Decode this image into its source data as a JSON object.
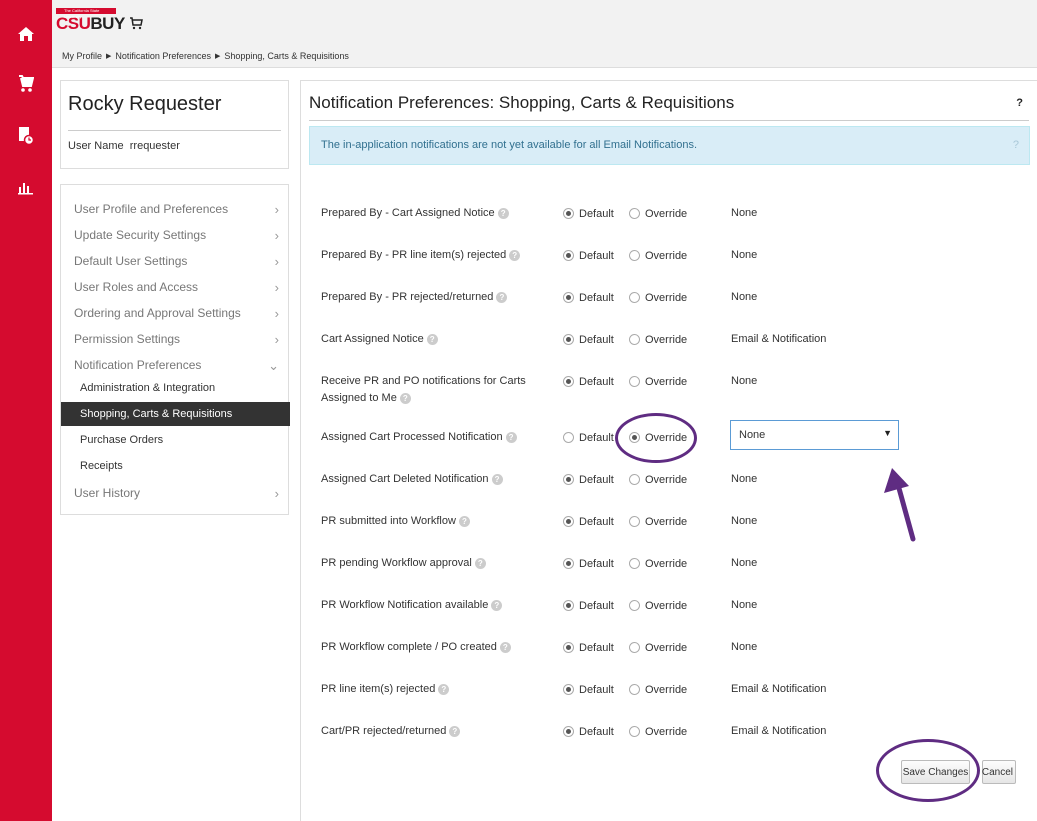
{
  "leftnav": {
    "icons": [
      "home-icon",
      "cart-icon",
      "document-clock-icon",
      "bar-chart-icon"
    ]
  },
  "header": {
    "logo_tagline": "The California State University",
    "logo_csu": "CSU",
    "logo_buy": "BUY"
  },
  "breadcrumb": [
    "My Profile",
    "Notification Preferences",
    "Shopping, Carts & Requisitions"
  ],
  "user": {
    "name": "Rocky Requester",
    "username_label": "User Name",
    "username": "rrequester"
  },
  "menu": {
    "items": [
      {
        "label": "User Profile and Preferences",
        "chevron": "›"
      },
      {
        "label": "Update Security Settings",
        "chevron": "›"
      },
      {
        "label": "Default User Settings",
        "chevron": "›"
      },
      {
        "label": "User Roles and Access",
        "chevron": "›"
      },
      {
        "label": "Ordering and Approval Settings",
        "chevron": "›"
      },
      {
        "label": "Permission Settings",
        "chevron": "›"
      },
      {
        "label": "Notification Preferences",
        "chevron": "⌄"
      }
    ],
    "subitems": [
      {
        "label": "Administration & Integration",
        "active": false
      },
      {
        "label": "Shopping, Carts & Requisitions",
        "active": true
      },
      {
        "label": "Purchase Orders",
        "active": false
      },
      {
        "label": "Receipts",
        "active": false
      }
    ],
    "last_item": {
      "label": "User History",
      "chevron": "›"
    }
  },
  "main": {
    "title": "Notification Preferences:  Shopping, Carts & Requisitions",
    "help": "?",
    "alert_text": "The in-application notifications are not yet available for all Email Notifications.",
    "alert_help": "?",
    "default_label": "Default",
    "override_label": "Override",
    "rows": [
      {
        "label": "Prepared By - Cart Assigned Notice",
        "selected": "default",
        "value": "None"
      },
      {
        "label": "Prepared By - PR line item(s) rejected",
        "selected": "default",
        "value": "None"
      },
      {
        "label": "Prepared By - PR rejected/returned",
        "selected": "default",
        "value": "None"
      },
      {
        "label": "Cart Assigned Notice",
        "selected": "default",
        "value": "Email & Notification"
      },
      {
        "label": "Receive PR and PO notifications for Carts Assigned to Me",
        "selected": "default",
        "value": "None"
      },
      {
        "label": "Assigned Cart Processed Notification",
        "selected": "override",
        "value": "None",
        "dropdown": true
      },
      {
        "label": "Assigned Cart Deleted Notification",
        "selected": "default",
        "value": "None"
      },
      {
        "label": "PR submitted into Workflow",
        "selected": "default",
        "value": "None"
      },
      {
        "label": "PR pending Workflow approval",
        "selected": "default",
        "value": "None"
      },
      {
        "label": "PR Workflow Notification available",
        "selected": "default",
        "value": "None"
      },
      {
        "label": "PR Workflow complete / PO created",
        "selected": "default",
        "value": "None"
      },
      {
        "label": "PR line item(s) rejected",
        "selected": "default",
        "value": "Email & Notification"
      },
      {
        "label": "Cart/PR rejected/returned",
        "selected": "default",
        "value": "Email & Notification"
      }
    ],
    "save_label": "Save Changes",
    "cancel_label": "Cancel"
  },
  "colors": {
    "nav_red": "#d50b2f",
    "annotation_purple": "#5f2c82"
  }
}
